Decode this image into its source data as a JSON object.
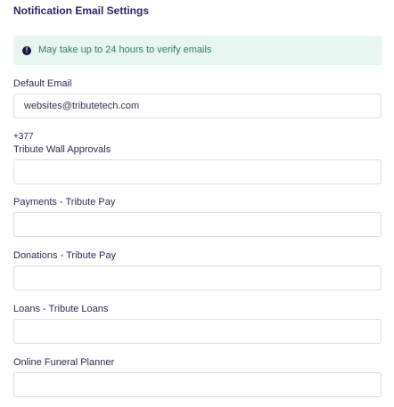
{
  "section": {
    "title": "Notification Email Settings"
  },
  "alert": {
    "icon": "info-icon",
    "glyph": "!",
    "text": "May take up to 24 hours to verify emails"
  },
  "default_email": {
    "label": "Default Email",
    "value": "websites@tributetech.com",
    "counter": "+377"
  },
  "tribute_wall": {
    "label": "Tribute Wall Approvals",
    "value": ""
  },
  "payments": {
    "label": "Payments - Tribute Pay",
    "value": ""
  },
  "donations": {
    "label": "Donations - Tribute Pay",
    "value": ""
  },
  "loans": {
    "label": "Loans - Tribute Loans",
    "value": ""
  },
  "planner": {
    "label": "Online Funeral Planner",
    "value": ""
  },
  "colors": {
    "title": "#2b2563",
    "alert_bg": "#e8f6f1",
    "alert_text": "#2e7d63",
    "border": "#dedede"
  }
}
